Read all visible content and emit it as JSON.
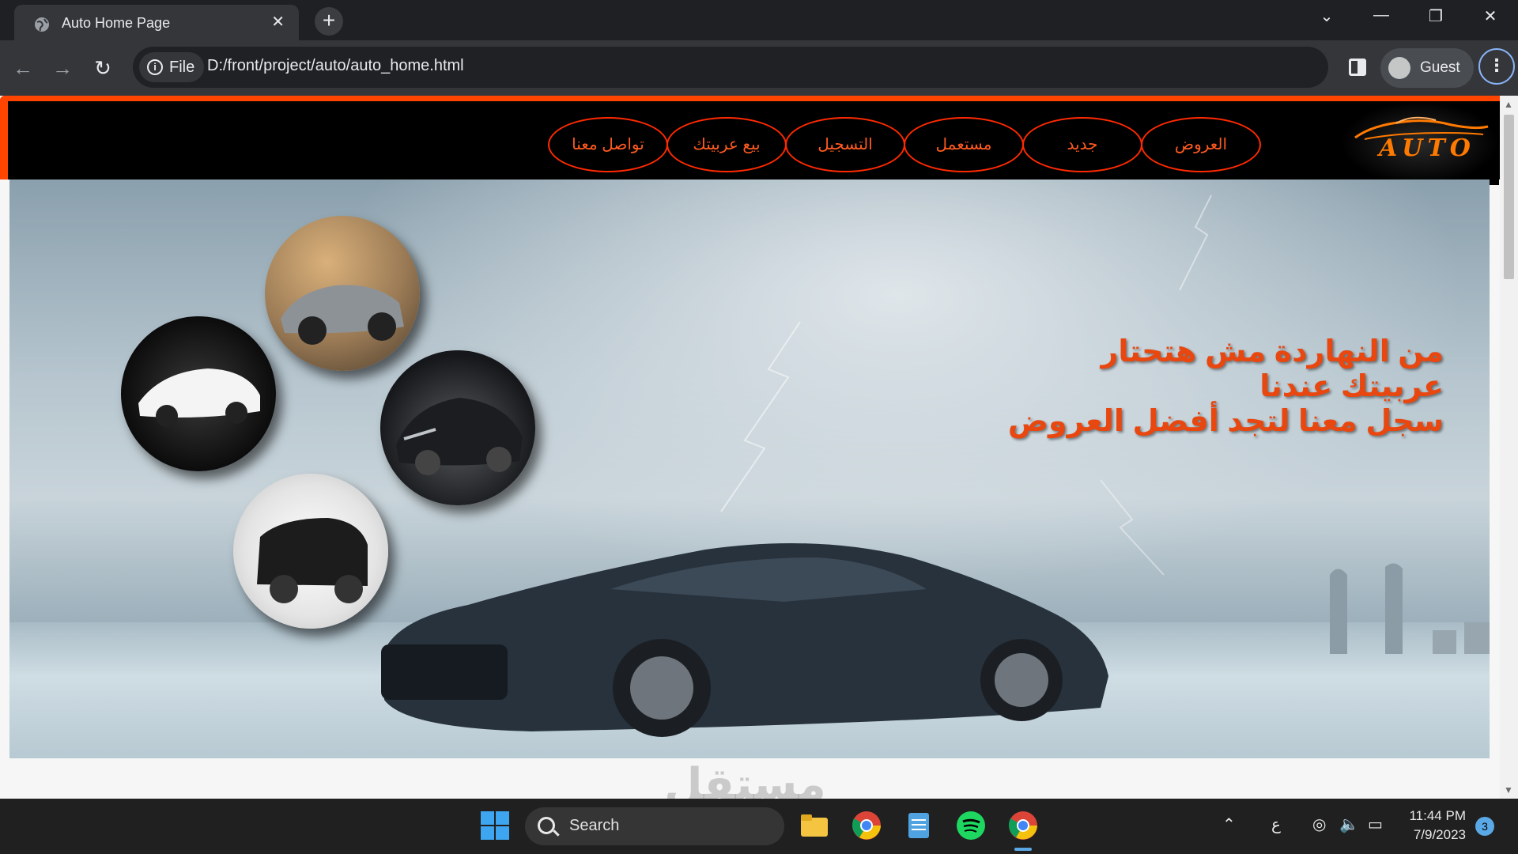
{
  "browser": {
    "tab_title": "Auto Home Page",
    "file_chip": "File",
    "url": "D:/front/project/auto/auto_home.html",
    "profile": "Guest"
  },
  "site": {
    "logo_text": "AUTO",
    "nav": [
      {
        "label": "العروض"
      },
      {
        "label": "جديد"
      },
      {
        "label": "مستعمل"
      },
      {
        "label": "التسجيل"
      },
      {
        "label": "بيع عربيتك"
      },
      {
        "label": "تواصل معنا"
      }
    ],
    "hero_lines": [
      "من النهاردة مش هتحتار",
      "عربيتك عندنا",
      "سجل معنا لتجد أفضل العروض"
    ],
    "accent_color": "#ff4500"
  },
  "watermark": "مستقل",
  "taskbar": {
    "search_label": "Search",
    "apps": [
      "windows-start-icon",
      "file-explorer-icon",
      "chrome-icon",
      "notepad-icon",
      "spotify-icon",
      "chrome-icon"
    ],
    "language": "ع",
    "time": "11:44 PM",
    "date": "7/9/2023",
    "notification_count": "3"
  }
}
